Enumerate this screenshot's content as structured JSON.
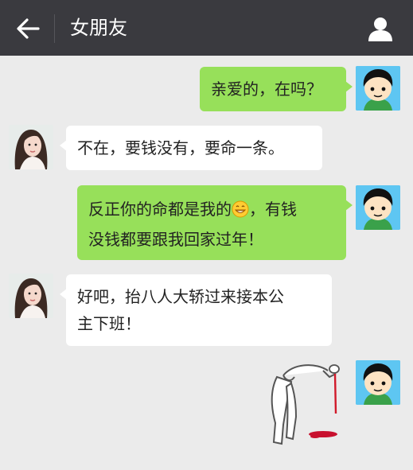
{
  "header": {
    "title": "女朋友",
    "back_icon": "arrow-left-icon",
    "profile_icon": "person-icon"
  },
  "messages": [
    {
      "sender": "me",
      "text": "亲爱的，在吗？"
    },
    {
      "sender": "girlfriend",
      "text": "不在，要钱没有，要命一条。"
    },
    {
      "sender": "me",
      "line1_before": "反正你的命都是我的",
      "line1_after": "，有钱",
      "line2": "没钱都要跟我回家过年！",
      "emoji": "grinning-face-emoji"
    },
    {
      "sender": "girlfriend",
      "line1": "好吧，抬八人大轿过来接本公",
      "line2": "主下班！"
    },
    {
      "sender": "me",
      "sticker": "bowing-stick-figure-bleeding-sticker"
    }
  ],
  "colors": {
    "header_bg": "#3a3a3f",
    "chat_bg": "#ebebeb",
    "my_bubble": "#97e05a",
    "other_bubble": "#ffffff"
  }
}
